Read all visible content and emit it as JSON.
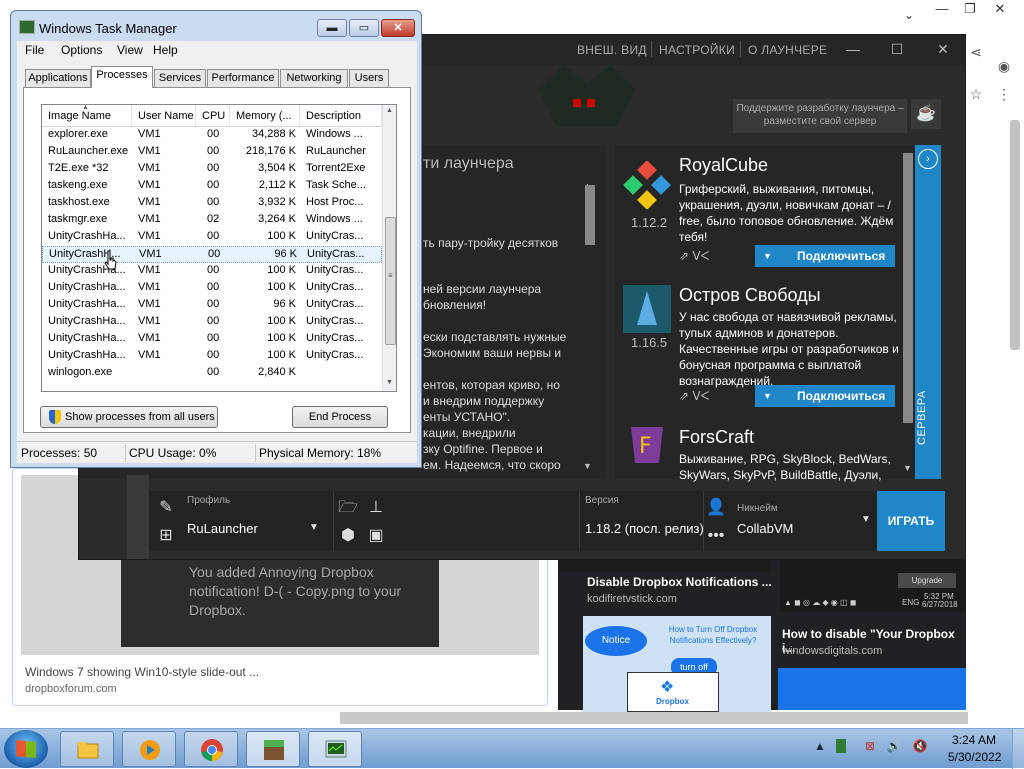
{
  "browser": {
    "cards": [
      {
        "title": "Windows 7 showing Win10-style slide-out ...",
        "source": "dropboxforum.com",
        "toast": "You added Annoying Dropbox notification! D-(  - Copy.png to your Dropbox."
      },
      {
        "title": "Disable Dropbox Notifications ...",
        "source": "kodifiretvstick.com"
      },
      {
        "title": "How to disable \"Your Dropbox i...",
        "source": "windowsdigitals.com"
      }
    ],
    "thumb_upgrade": "Upgrade",
    "thumb_taskbar_time": "5:32 PM",
    "thumb_taskbar_date": "6/27/2018",
    "thumb_taskbar_lang": "ENG",
    "notice": {
      "bubble": "Notice",
      "question": "How to Turn Off Dropbox Notifications Effectively?",
      "turn_off": "turn off",
      "brand": "Dropbox"
    }
  },
  "launcher": {
    "nav": [
      "ВНЕШ. ВИД",
      "НАСТРОЙКИ",
      "О ЛАУНЧЕРЕ"
    ],
    "support": "Поддержите разработку лаунчера – разместите свой сервер",
    "news_heading": "ти лаунчера",
    "news_lines": [
      "ть пару-тройку десятков",
      "",
      "ней версии лаунчера",
      "бновления!",
      "",
      "ески подставлять нужные",
      "Экономим ваши нервы и",
      "",
      "ентов, которая криво, но",
      "и внедрим поддержку",
      "енты УСТАНО\".",
      "кации, внедрили",
      "зку Optifine. Первое и",
      "ем. Надеемся, что скоро"
    ],
    "servers": [
      {
        "name": "RoyalCube",
        "version": "1.12.2",
        "desc": "Гриферский, выживания, питомцы, украшения, дуэли, новичкам донат – / free, было топовое обновление. Ждём тебя!",
        "connect": "Подключиться"
      },
      {
        "name": "Остров Свободы",
        "version": "1.16.5",
        "desc": "У нас свобода от навязчивой рекламы, тупых админов и донатеров. Качественные игры от разработчиков и бонусная программа с выплатой вознаграждений.",
        "connect": "Подключиться"
      },
      {
        "name": "ForsCraft",
        "version": "",
        "desc": "Выживание, RPG, SkyBlock, BedWars, SkyWars, SkyPvP, BuildBattle, Дуэли,",
        "connect": ""
      }
    ],
    "servers_tab": "СЕРВЕРА",
    "profile_label": "Профиль",
    "profile_value": "RuLauncher",
    "version_label": "Версия",
    "version_value": "1.18.2 (посл. релиз)",
    "nick_label": "Никнейм",
    "nick_value": "CollabVM",
    "play": "ИГРАТЬ"
  },
  "taskmgr": {
    "title": "Windows Task Manager",
    "menu": [
      "File",
      "Options",
      "View",
      "Help"
    ],
    "tabs": [
      "Applications",
      "Processes",
      "Services",
      "Performance",
      "Networking",
      "Users"
    ],
    "active_tab": 1,
    "columns": [
      "Image Name",
      "User Name",
      "CPU",
      "Memory (...",
      "Description"
    ],
    "rows": [
      [
        "explorer.exe",
        "VM1",
        "00",
        "34,288 K",
        "Windows ..."
      ],
      [
        "RuLauncher.exe",
        "VM1",
        "00",
        "218,176 K",
        "RuLauncher"
      ],
      [
        "T2E.exe *32",
        "VM1",
        "00",
        "3,504 K",
        "Torrent2Exe"
      ],
      [
        "taskeng.exe",
        "VM1",
        "00",
        "2,112 K",
        "Task Sche..."
      ],
      [
        "taskhost.exe",
        "VM1",
        "00",
        "3,932 K",
        "Host Proc..."
      ],
      [
        "taskmgr.exe",
        "VM1",
        "02",
        "3,264 K",
        "Windows ..."
      ],
      [
        "UnityCrashHa...",
        "VM1",
        "00",
        "100 K",
        "UnityCras..."
      ],
      [
        "UnityCrashH...",
        "VM1",
        "00",
        "96 K",
        "UnityCras..."
      ],
      [
        "UnityCrashHa...",
        "VM1",
        "00",
        "100 K",
        "UnityCras..."
      ],
      [
        "UnityCrashHa...",
        "VM1",
        "00",
        "100 K",
        "UnityCras..."
      ],
      [
        "UnityCrashHa...",
        "VM1",
        "00",
        "96 K",
        "UnityCras..."
      ],
      [
        "UnityCrashHa...",
        "VM1",
        "00",
        "100 K",
        "UnityCras..."
      ],
      [
        "UnityCrashHa...",
        "VM1",
        "00",
        "100 K",
        "UnityCras..."
      ],
      [
        "UnityCrashHa...",
        "VM1",
        "00",
        "100 K",
        "UnityCras..."
      ],
      [
        "winlogon.exe",
        "",
        "00",
        "2,840 K",
        ""
      ]
    ],
    "selected_row": 7,
    "show_all": "Show processes from all users",
    "end_process": "End Process",
    "status": {
      "processes": "Processes: 50",
      "cpu": "CPU Usage: 0%",
      "memory": "Physical Memory: 18%"
    }
  },
  "taskbar": {
    "time": "3:24 AM",
    "date": "5/30/2022"
  },
  "colors": {
    "launcher_accent": "#1f86c8",
    "taskbar": "#6f9cd1"
  }
}
